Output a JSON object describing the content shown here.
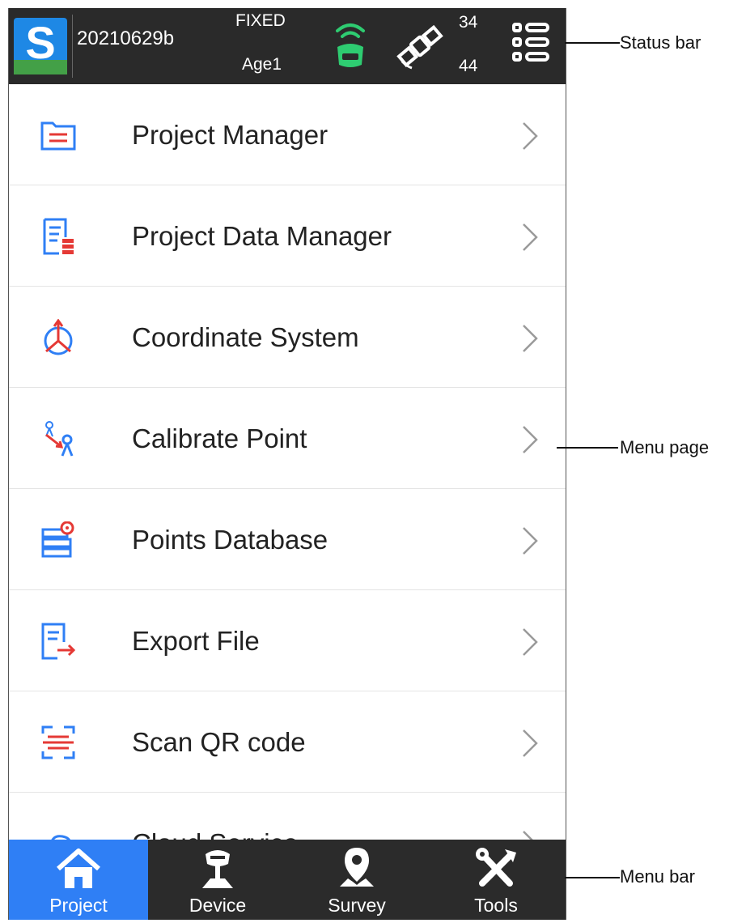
{
  "status_bar": {
    "project_name": "20210629b",
    "fix_status": "FIXED",
    "age": "Age1",
    "satellites_top": "34",
    "satellites_bottom": "44"
  },
  "menu": {
    "items": [
      {
        "label": "Project Manager",
        "icon": "project-manager-icon"
      },
      {
        "label": "Project Data Manager",
        "icon": "project-data-manager-icon"
      },
      {
        "label": "Coordinate System",
        "icon": "coordinate-system-icon"
      },
      {
        "label": "Calibrate Point",
        "icon": "calibrate-point-icon"
      },
      {
        "label": "Points Database",
        "icon": "points-database-icon"
      },
      {
        "label": "Export File",
        "icon": "export-file-icon"
      },
      {
        "label": "Scan QR code",
        "icon": "scan-qr-icon"
      },
      {
        "label": "Cloud Service",
        "icon": "cloud-service-icon"
      }
    ]
  },
  "tabs": [
    {
      "label": "Project",
      "icon": "home-icon",
      "active": true
    },
    {
      "label": "Device",
      "icon": "receiver-icon",
      "active": false
    },
    {
      "label": "Survey",
      "icon": "location-pin-icon",
      "active": false
    },
    {
      "label": "Tools",
      "icon": "tools-icon",
      "active": false
    }
  ],
  "callouts": {
    "status_bar": "Status bar",
    "menu_page": "Menu page",
    "menu_bar": "Menu bar"
  },
  "colors": {
    "status_bg": "#2a2a2a",
    "accent_blue": "#2f7ff5",
    "icon_red": "#e53935",
    "icon_blue": "#2f7ff5",
    "receiver_green": "#2ecc71"
  }
}
